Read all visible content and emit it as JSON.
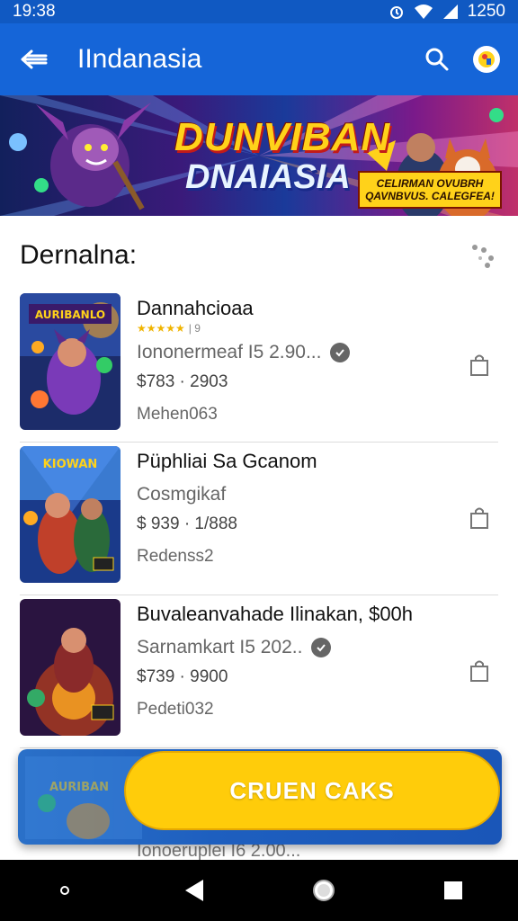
{
  "status_bar": {
    "time": "19:38",
    "battery": "1250"
  },
  "app_bar": {
    "title": "IIndanasia",
    "back_icon": "back-arrow-icon",
    "search_icon": "search-icon",
    "avatar_icon": "account-avatar-icon"
  },
  "banner": {
    "title_line1": "DUNVIBAN",
    "title_line2": "DNAIASIA",
    "tag_line1": "CELIRMAN OVUBRH",
    "tag_line2": "QAVNBVUS. CALEGFEA!"
  },
  "section": {
    "title": "Dernalna:",
    "more_icon": "dots-icon"
  },
  "items": [
    {
      "title": "Dannahcioaa",
      "rating_text": "★★★★★",
      "rating_num": "| 9",
      "line2": "Iononermeaf I5 2.90...",
      "line3": "$783 · 2903",
      "line4": "Mehen063",
      "thumb_label": "AURIBANLO"
    },
    {
      "title": "Püphliai Sa Gcanom",
      "rating_text": "",
      "rating_num": "",
      "line2": "Cosmgikaf",
      "line3": "$ 939 · 1/888",
      "line4": "Redenss2",
      "thumb_label": "KIOWAN"
    },
    {
      "title": "Buvaleanvahade Ilinakan, $00h",
      "rating_text": "",
      "rating_num": "",
      "line2": "Sarnamkart I5 202..",
      "line3": "$739 · 9900",
      "line4": "Pedeti032",
      "thumb_label": ""
    }
  ],
  "cta": {
    "label": "CRUEN CAKS"
  },
  "peek_line": "Ionoeruplei I6 2.00...",
  "colors": {
    "app_bar": "#1565d8",
    "cta_yellow": "#ffcc0a"
  }
}
